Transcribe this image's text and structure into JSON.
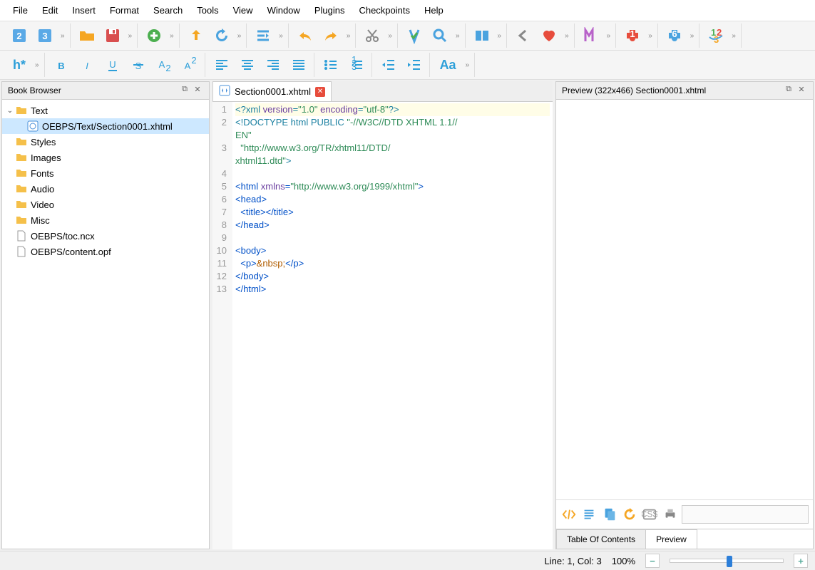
{
  "menubar": [
    "File",
    "Edit",
    "Insert",
    "Format",
    "Search",
    "Tools",
    "View",
    "Window",
    "Plugins",
    "Checkpoints",
    "Help"
  ],
  "toolbar1": {
    "groups": [
      [
        "epub2",
        "epub3"
      ],
      [
        "open",
        "save"
      ],
      [
        "add"
      ],
      [
        "upload",
        "refresh"
      ],
      [
        "indent-left"
      ],
      [
        "undo",
        "redo"
      ],
      [
        "cut"
      ],
      [
        "validate",
        "find"
      ],
      [
        "split-view"
      ],
      [
        "back",
        "heart"
      ],
      [
        "metadata"
      ],
      [
        "plugin-red"
      ],
      [
        "plugin-blue"
      ],
      [
        "plugin-numbers"
      ]
    ]
  },
  "toolbar2": {
    "heading_label": "h*",
    "format": [
      "bold",
      "italic",
      "underline",
      "strike",
      "subscript",
      "superscript"
    ],
    "align": [
      "align-left",
      "align-center",
      "align-right",
      "align-justify"
    ],
    "lists": [
      "list-bullet",
      "list-number"
    ],
    "indent": [
      "outdent",
      "indent"
    ],
    "font_label": "Aa"
  },
  "book_browser": {
    "title": "Book Browser",
    "nodes": [
      {
        "type": "folder",
        "label": "Text",
        "expanded": true,
        "depth": 0
      },
      {
        "type": "html",
        "label": "OEBPS/Text/Section0001.xhtml",
        "depth": 1,
        "selected": true
      },
      {
        "type": "folder",
        "label": "Styles",
        "depth": 0
      },
      {
        "type": "folder",
        "label": "Images",
        "depth": 0
      },
      {
        "type": "folder",
        "label": "Fonts",
        "depth": 0
      },
      {
        "type": "folder",
        "label": "Audio",
        "depth": 0
      },
      {
        "type": "folder",
        "label": "Video",
        "depth": 0
      },
      {
        "type": "folder",
        "label": "Misc",
        "depth": 0
      },
      {
        "type": "file",
        "label": "OEBPS/toc.ncx",
        "depth": 0
      },
      {
        "type": "file",
        "label": "OEBPS/content.opf",
        "depth": 0
      }
    ]
  },
  "editor": {
    "tab_title": "Section0001.xhtml",
    "lines": [
      {
        "n": 1,
        "hl": true,
        "tokens": [
          {
            "t": "<?xml ",
            "c": "pi"
          },
          {
            "t": "version",
            "c": "attr"
          },
          {
            "t": "=",
            "c": "pi"
          },
          {
            "t": "\"1.0\"",
            "c": "str"
          },
          {
            "t": " ",
            "c": "pi"
          },
          {
            "t": "encoding",
            "c": "attr"
          },
          {
            "t": "=",
            "c": "pi"
          },
          {
            "t": "\"utf-8\"",
            "c": "str"
          },
          {
            "t": "?>",
            "c": "pi"
          }
        ]
      },
      {
        "n": 2,
        "tokens": [
          {
            "t": "<!DOCTYPE html PUBLIC ",
            "c": "doc"
          },
          {
            "t": "\"-//W3C//DTD XHTML 1.1//",
            "c": "str"
          }
        ]
      },
      {
        "n": "",
        "tokens": [
          {
            "t": "EN\"",
            "c": "str"
          }
        ]
      },
      {
        "n": 3,
        "tokens": [
          {
            "t": "  ",
            "c": "plain"
          },
          {
            "t": "\"http://www.w3.org/TR/xhtml11/DTD/",
            "c": "str"
          }
        ]
      },
      {
        "n": "",
        "tokens": [
          {
            "t": "xhtml11.dtd\"",
            "c": "str"
          },
          {
            "t": ">",
            "c": "doc"
          }
        ]
      },
      {
        "n": 4,
        "tokens": []
      },
      {
        "n": 5,
        "tokens": [
          {
            "t": "<html ",
            "c": "tag"
          },
          {
            "t": "xmlns",
            "c": "attr"
          },
          {
            "t": "=",
            "c": "tag"
          },
          {
            "t": "\"http://www.w3.org/1999/xhtml\"",
            "c": "str"
          },
          {
            "t": ">",
            "c": "tag"
          }
        ]
      },
      {
        "n": 6,
        "tokens": [
          {
            "t": "<head>",
            "c": "tag"
          }
        ]
      },
      {
        "n": 7,
        "tokens": [
          {
            "t": "  ",
            "c": "plain"
          },
          {
            "t": "<title></title>",
            "c": "tag"
          }
        ]
      },
      {
        "n": 8,
        "tokens": [
          {
            "t": "</head>",
            "c": "tag"
          }
        ]
      },
      {
        "n": 9,
        "tokens": []
      },
      {
        "n": 10,
        "tokens": [
          {
            "t": "<body>",
            "c": "tag"
          }
        ]
      },
      {
        "n": 11,
        "tokens": [
          {
            "t": "  ",
            "c": "plain"
          },
          {
            "t": "<p>",
            "c": "tag"
          },
          {
            "t": "&nbsp;",
            "c": "ent"
          },
          {
            "t": "</p>",
            "c": "tag"
          }
        ]
      },
      {
        "n": 12,
        "tokens": [
          {
            "t": "</body>",
            "c": "tag"
          }
        ]
      },
      {
        "n": 13,
        "tokens": [
          {
            "t": "</html>",
            "c": "tag"
          }
        ]
      }
    ]
  },
  "preview": {
    "title": "Preview (322x466) Section0001.xhtml",
    "tools": [
      "code-view",
      "raw-view",
      "copy",
      "reload",
      "css",
      "print"
    ],
    "tabs": [
      "Table Of Contents",
      "Preview"
    ],
    "active_tab": 1
  },
  "status": {
    "position": "Line: 1, Col: 3",
    "zoom": "100%"
  }
}
